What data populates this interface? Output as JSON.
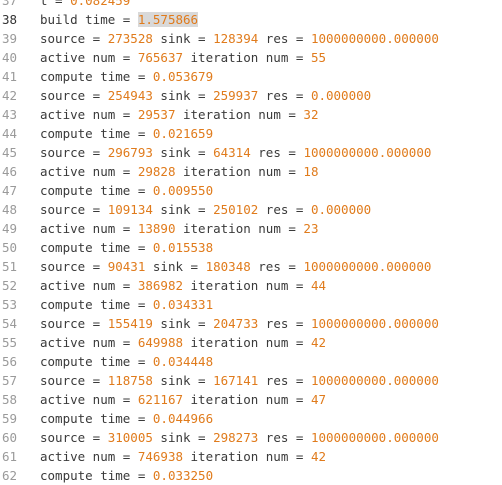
{
  "colors": {
    "number": "#e07b1c",
    "text": "#3a3a3a",
    "gutter": "#9a9a9a",
    "gutter_current": "#333333",
    "selection": "#d9d9d9"
  },
  "editor": {
    "current_line": 38,
    "selected_number_line": 38,
    "lines": [
      {
        "n": "37",
        "parts": [
          {
            "t": "t = ",
            "c": "text"
          },
          {
            "t": "0.082459",
            "c": "num"
          }
        ]
      },
      {
        "n": "38",
        "parts": [
          {
            "t": "build time = ",
            "c": "text"
          },
          {
            "t": "1.575866",
            "c": "num"
          }
        ]
      },
      {
        "n": "39",
        "parts": [
          {
            "t": "source = ",
            "c": "text"
          },
          {
            "t": "273528",
            "c": "num"
          },
          {
            "t": " sink = ",
            "c": "text"
          },
          {
            "t": "128394",
            "c": "num"
          },
          {
            "t": " res = ",
            "c": "text"
          },
          {
            "t": "1000000000.000000",
            "c": "num"
          }
        ]
      },
      {
        "n": "40",
        "parts": [
          {
            "t": "active num = ",
            "c": "text"
          },
          {
            "t": "765637",
            "c": "num"
          },
          {
            "t": " iteration num = ",
            "c": "text"
          },
          {
            "t": "55",
            "c": "num"
          }
        ]
      },
      {
        "n": "41",
        "parts": [
          {
            "t": "compute time = ",
            "c": "text"
          },
          {
            "t": "0.053679",
            "c": "num"
          }
        ]
      },
      {
        "n": "42",
        "parts": [
          {
            "t": "source = ",
            "c": "text"
          },
          {
            "t": "254943",
            "c": "num"
          },
          {
            "t": " sink = ",
            "c": "text"
          },
          {
            "t": "259937",
            "c": "num"
          },
          {
            "t": " res = ",
            "c": "text"
          },
          {
            "t": "0.000000",
            "c": "num"
          }
        ]
      },
      {
        "n": "43",
        "parts": [
          {
            "t": "active num = ",
            "c": "text"
          },
          {
            "t": "29537",
            "c": "num"
          },
          {
            "t": " iteration num = ",
            "c": "text"
          },
          {
            "t": "32",
            "c": "num"
          }
        ]
      },
      {
        "n": "44",
        "parts": [
          {
            "t": "compute time = ",
            "c": "text"
          },
          {
            "t": "0.021659",
            "c": "num"
          }
        ]
      },
      {
        "n": "45",
        "parts": [
          {
            "t": "source = ",
            "c": "text"
          },
          {
            "t": "296793",
            "c": "num"
          },
          {
            "t": " sink = ",
            "c": "text"
          },
          {
            "t": "64314",
            "c": "num"
          },
          {
            "t": " res = ",
            "c": "text"
          },
          {
            "t": "1000000000.000000",
            "c": "num"
          }
        ]
      },
      {
        "n": "46",
        "parts": [
          {
            "t": "active num = ",
            "c": "text"
          },
          {
            "t": "29828",
            "c": "num"
          },
          {
            "t": " iteration num = ",
            "c": "text"
          },
          {
            "t": "18",
            "c": "num"
          }
        ]
      },
      {
        "n": "47",
        "parts": [
          {
            "t": "compute time = ",
            "c": "text"
          },
          {
            "t": "0.009550",
            "c": "num"
          }
        ]
      },
      {
        "n": "48",
        "parts": [
          {
            "t": "source = ",
            "c": "text"
          },
          {
            "t": "109134",
            "c": "num"
          },
          {
            "t": " sink = ",
            "c": "text"
          },
          {
            "t": "250102",
            "c": "num"
          },
          {
            "t": " res = ",
            "c": "text"
          },
          {
            "t": "0.000000",
            "c": "num"
          }
        ]
      },
      {
        "n": "49",
        "parts": [
          {
            "t": "active num = ",
            "c": "text"
          },
          {
            "t": "13890",
            "c": "num"
          },
          {
            "t": " iteration num = ",
            "c": "text"
          },
          {
            "t": "23",
            "c": "num"
          }
        ]
      },
      {
        "n": "50",
        "parts": [
          {
            "t": "compute time = ",
            "c": "text"
          },
          {
            "t": "0.015538",
            "c": "num"
          }
        ]
      },
      {
        "n": "51",
        "parts": [
          {
            "t": "source = ",
            "c": "text"
          },
          {
            "t": "90431",
            "c": "num"
          },
          {
            "t": " sink = ",
            "c": "text"
          },
          {
            "t": "180348",
            "c": "num"
          },
          {
            "t": " res = ",
            "c": "text"
          },
          {
            "t": "1000000000.000000",
            "c": "num"
          }
        ]
      },
      {
        "n": "52",
        "parts": [
          {
            "t": "active num = ",
            "c": "text"
          },
          {
            "t": "386982",
            "c": "num"
          },
          {
            "t": " iteration num = ",
            "c": "text"
          },
          {
            "t": "44",
            "c": "num"
          }
        ]
      },
      {
        "n": "53",
        "parts": [
          {
            "t": "compute time = ",
            "c": "text"
          },
          {
            "t": "0.034331",
            "c": "num"
          }
        ]
      },
      {
        "n": "54",
        "parts": [
          {
            "t": "source = ",
            "c": "text"
          },
          {
            "t": "155419",
            "c": "num"
          },
          {
            "t": " sink = ",
            "c": "text"
          },
          {
            "t": "204733",
            "c": "num"
          },
          {
            "t": " res = ",
            "c": "text"
          },
          {
            "t": "1000000000.000000",
            "c": "num"
          }
        ]
      },
      {
        "n": "55",
        "parts": [
          {
            "t": "active num = ",
            "c": "text"
          },
          {
            "t": "649988",
            "c": "num"
          },
          {
            "t": " iteration num = ",
            "c": "text"
          },
          {
            "t": "42",
            "c": "num"
          }
        ]
      },
      {
        "n": "56",
        "parts": [
          {
            "t": "compute time = ",
            "c": "text"
          },
          {
            "t": "0.034448",
            "c": "num"
          }
        ]
      },
      {
        "n": "57",
        "parts": [
          {
            "t": "source = ",
            "c": "text"
          },
          {
            "t": "118758",
            "c": "num"
          },
          {
            "t": " sink = ",
            "c": "text"
          },
          {
            "t": "167141",
            "c": "num"
          },
          {
            "t": " res = ",
            "c": "text"
          },
          {
            "t": "1000000000.000000",
            "c": "num"
          }
        ]
      },
      {
        "n": "58",
        "parts": [
          {
            "t": "active num = ",
            "c": "text"
          },
          {
            "t": "621167",
            "c": "num"
          },
          {
            "t": " iteration num = ",
            "c": "text"
          },
          {
            "t": "47",
            "c": "num"
          }
        ]
      },
      {
        "n": "59",
        "parts": [
          {
            "t": "compute time = ",
            "c": "text"
          },
          {
            "t": "0.044966",
            "c": "num"
          }
        ]
      },
      {
        "n": "60",
        "parts": [
          {
            "t": "source = ",
            "c": "text"
          },
          {
            "t": "310005",
            "c": "num"
          },
          {
            "t": " sink = ",
            "c": "text"
          },
          {
            "t": "298273",
            "c": "num"
          },
          {
            "t": " res = ",
            "c": "text"
          },
          {
            "t": "1000000000.000000",
            "c": "num"
          }
        ]
      },
      {
        "n": "61",
        "parts": [
          {
            "t": "active num = ",
            "c": "text"
          },
          {
            "t": "746938",
            "c": "num"
          },
          {
            "t": " iteration num = ",
            "c": "text"
          },
          {
            "t": "42",
            "c": "num"
          }
        ]
      },
      {
        "n": "62",
        "parts": [
          {
            "t": "compute time = ",
            "c": "text"
          },
          {
            "t": "0.033250",
            "c": "num"
          }
        ]
      }
    ]
  }
}
